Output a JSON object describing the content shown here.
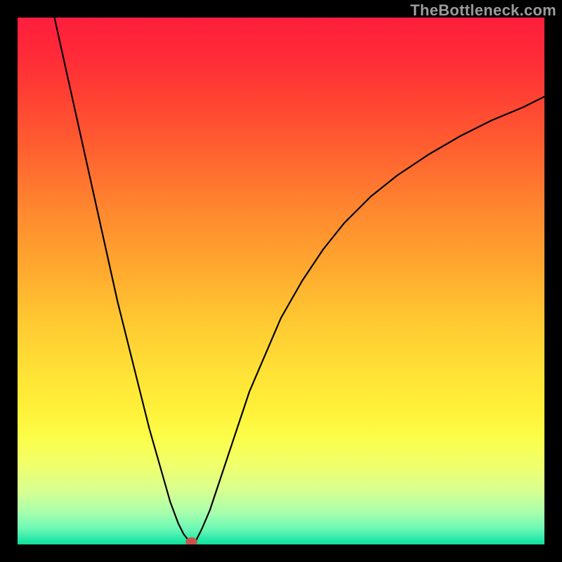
{
  "watermark": "TheBottleneck.com",
  "chart_data": {
    "type": "line",
    "title": "",
    "xlabel": "",
    "ylabel": "",
    "xlim": [
      0,
      100
    ],
    "ylim": [
      0,
      100
    ],
    "background_gradient_stops": [
      {
        "offset": 0.0,
        "color": "#ff1e3c"
      },
      {
        "offset": 0.07,
        "color": "#ff2a38"
      },
      {
        "offset": 0.15,
        "color": "#ff4133"
      },
      {
        "offset": 0.25,
        "color": "#ff6030"
      },
      {
        "offset": 0.36,
        "color": "#ff862f"
      },
      {
        "offset": 0.48,
        "color": "#ffaa2f"
      },
      {
        "offset": 0.58,
        "color": "#ffca32"
      },
      {
        "offset": 0.68,
        "color": "#ffe336"
      },
      {
        "offset": 0.75,
        "color": "#fff23a"
      },
      {
        "offset": 0.8,
        "color": "#fbfe4a"
      },
      {
        "offset": 0.85,
        "color": "#f0ff6c"
      },
      {
        "offset": 0.9,
        "color": "#d6ff92"
      },
      {
        "offset": 0.94,
        "color": "#a6ffad"
      },
      {
        "offset": 0.97,
        "color": "#6cf8b4"
      },
      {
        "offset": 0.99,
        "color": "#2ae9a8"
      },
      {
        "offset": 1.0,
        "color": "#10df99"
      }
    ],
    "series": [
      {
        "name": "bottleneck-curve",
        "color": "#000000",
        "stroke_width": 2.2,
        "x": [
          7,
          9,
          11,
          13,
          15,
          17,
          19,
          21,
          23,
          25,
          27,
          29,
          30.5,
          31.5,
          32.5,
          33,
          33.5,
          34,
          35,
          36.5,
          38,
          40,
          42,
          44,
          47,
          50,
          54,
          58,
          62,
          67,
          72,
          78,
          84,
          90,
          96,
          100
        ],
        "y": [
          100,
          91,
          82,
          73,
          64,
          55,
          46,
          38,
          30,
          22,
          15,
          8,
          4,
          2,
          0.7,
          0.3,
          0.3,
          1,
          3,
          6.5,
          11,
          17,
          23,
          29,
          36,
          43,
          50,
          56,
          61,
          66,
          70,
          74,
          77.5,
          80.5,
          83,
          85
        ]
      }
    ],
    "marker": {
      "name": "optimal-point",
      "x": 33,
      "y": 0.5,
      "rx": 1.1,
      "ry": 0.85,
      "fill": "#c9544b"
    }
  }
}
